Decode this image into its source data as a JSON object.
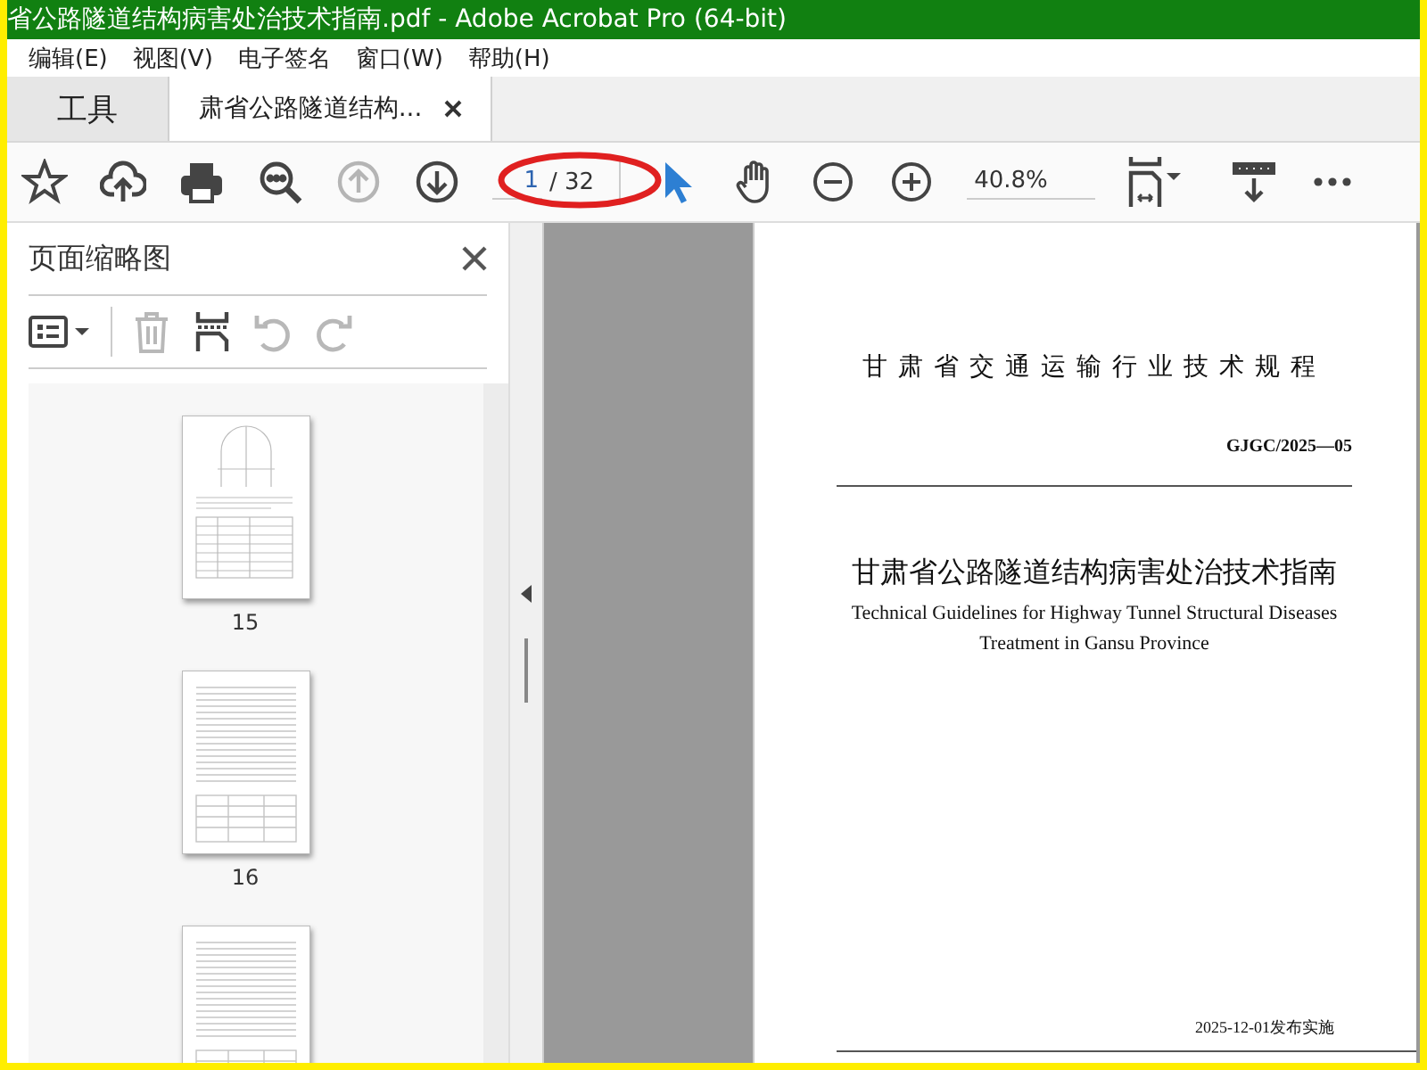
{
  "window": {
    "title": "省公路隧道结构病害处治技术指南.pdf - Adobe Acrobat Pro (64-bit)"
  },
  "menu": [
    "编辑(E)",
    "视图(V)",
    "电子签名",
    "窗口(W)",
    "帮助(H)"
  ],
  "tabs": [
    {
      "label": "工具",
      "selected": false,
      "closable": false
    },
    {
      "label": "肃省公路隧道结构...",
      "selected": true,
      "closable": true
    }
  ],
  "toolbar": {
    "tools_a": [
      {
        "kind": "star",
        "disabled": false
      },
      {
        "kind": "upload",
        "disabled": false
      },
      {
        "kind": "print",
        "disabled": false
      },
      {
        "kind": "search",
        "disabled": false
      },
      {
        "kind": "prev",
        "disabled": true
      },
      {
        "kind": "next",
        "disabled": false
      }
    ],
    "page_field": {
      "value": "1",
      "total": "/ 32"
    },
    "tools_b": [
      {
        "kind": "pointer",
        "selected": true
      },
      {
        "kind": "hand",
        "selected": false
      },
      {
        "kind": "zoom-out",
        "selected": false
      },
      {
        "kind": "zoom-in",
        "selected": false
      }
    ],
    "zoom_field": {
      "value": "40.8%"
    },
    "tools_c": [
      {
        "kind": "fit"
      },
      {
        "kind": "scroll"
      },
      {
        "kind": "more"
      }
    ]
  },
  "annotation": {
    "kind": "ellipse",
    "color": "#e02020"
  },
  "panel": {
    "title": "页面缩略图",
    "tools": [
      {
        "kind": "options",
        "disabled": false
      },
      {
        "kind": "trash",
        "disabled": true
      },
      {
        "kind": "insert",
        "disabled": false
      },
      {
        "kind": "rotate-left",
        "disabled": true
      },
      {
        "kind": "rotate-right",
        "disabled": true
      }
    ],
    "thumbnails": [
      {
        "label": "15",
        "kind": "figure"
      },
      {
        "label": "16",
        "kind": "text"
      },
      {
        "kind": "text"
      }
    ]
  },
  "document": {
    "series_title": "甘肃省交通运输行业技术规程",
    "code": "GJGC/2025—05",
    "title": "甘肃省公路隧道结构病害处治技术指南",
    "subtitle_en": "Technical Guidelines for Highway Tunnel Structural Diseases Treatment in Gansu Province",
    "footer": "2025-12-01发布实施"
  }
}
